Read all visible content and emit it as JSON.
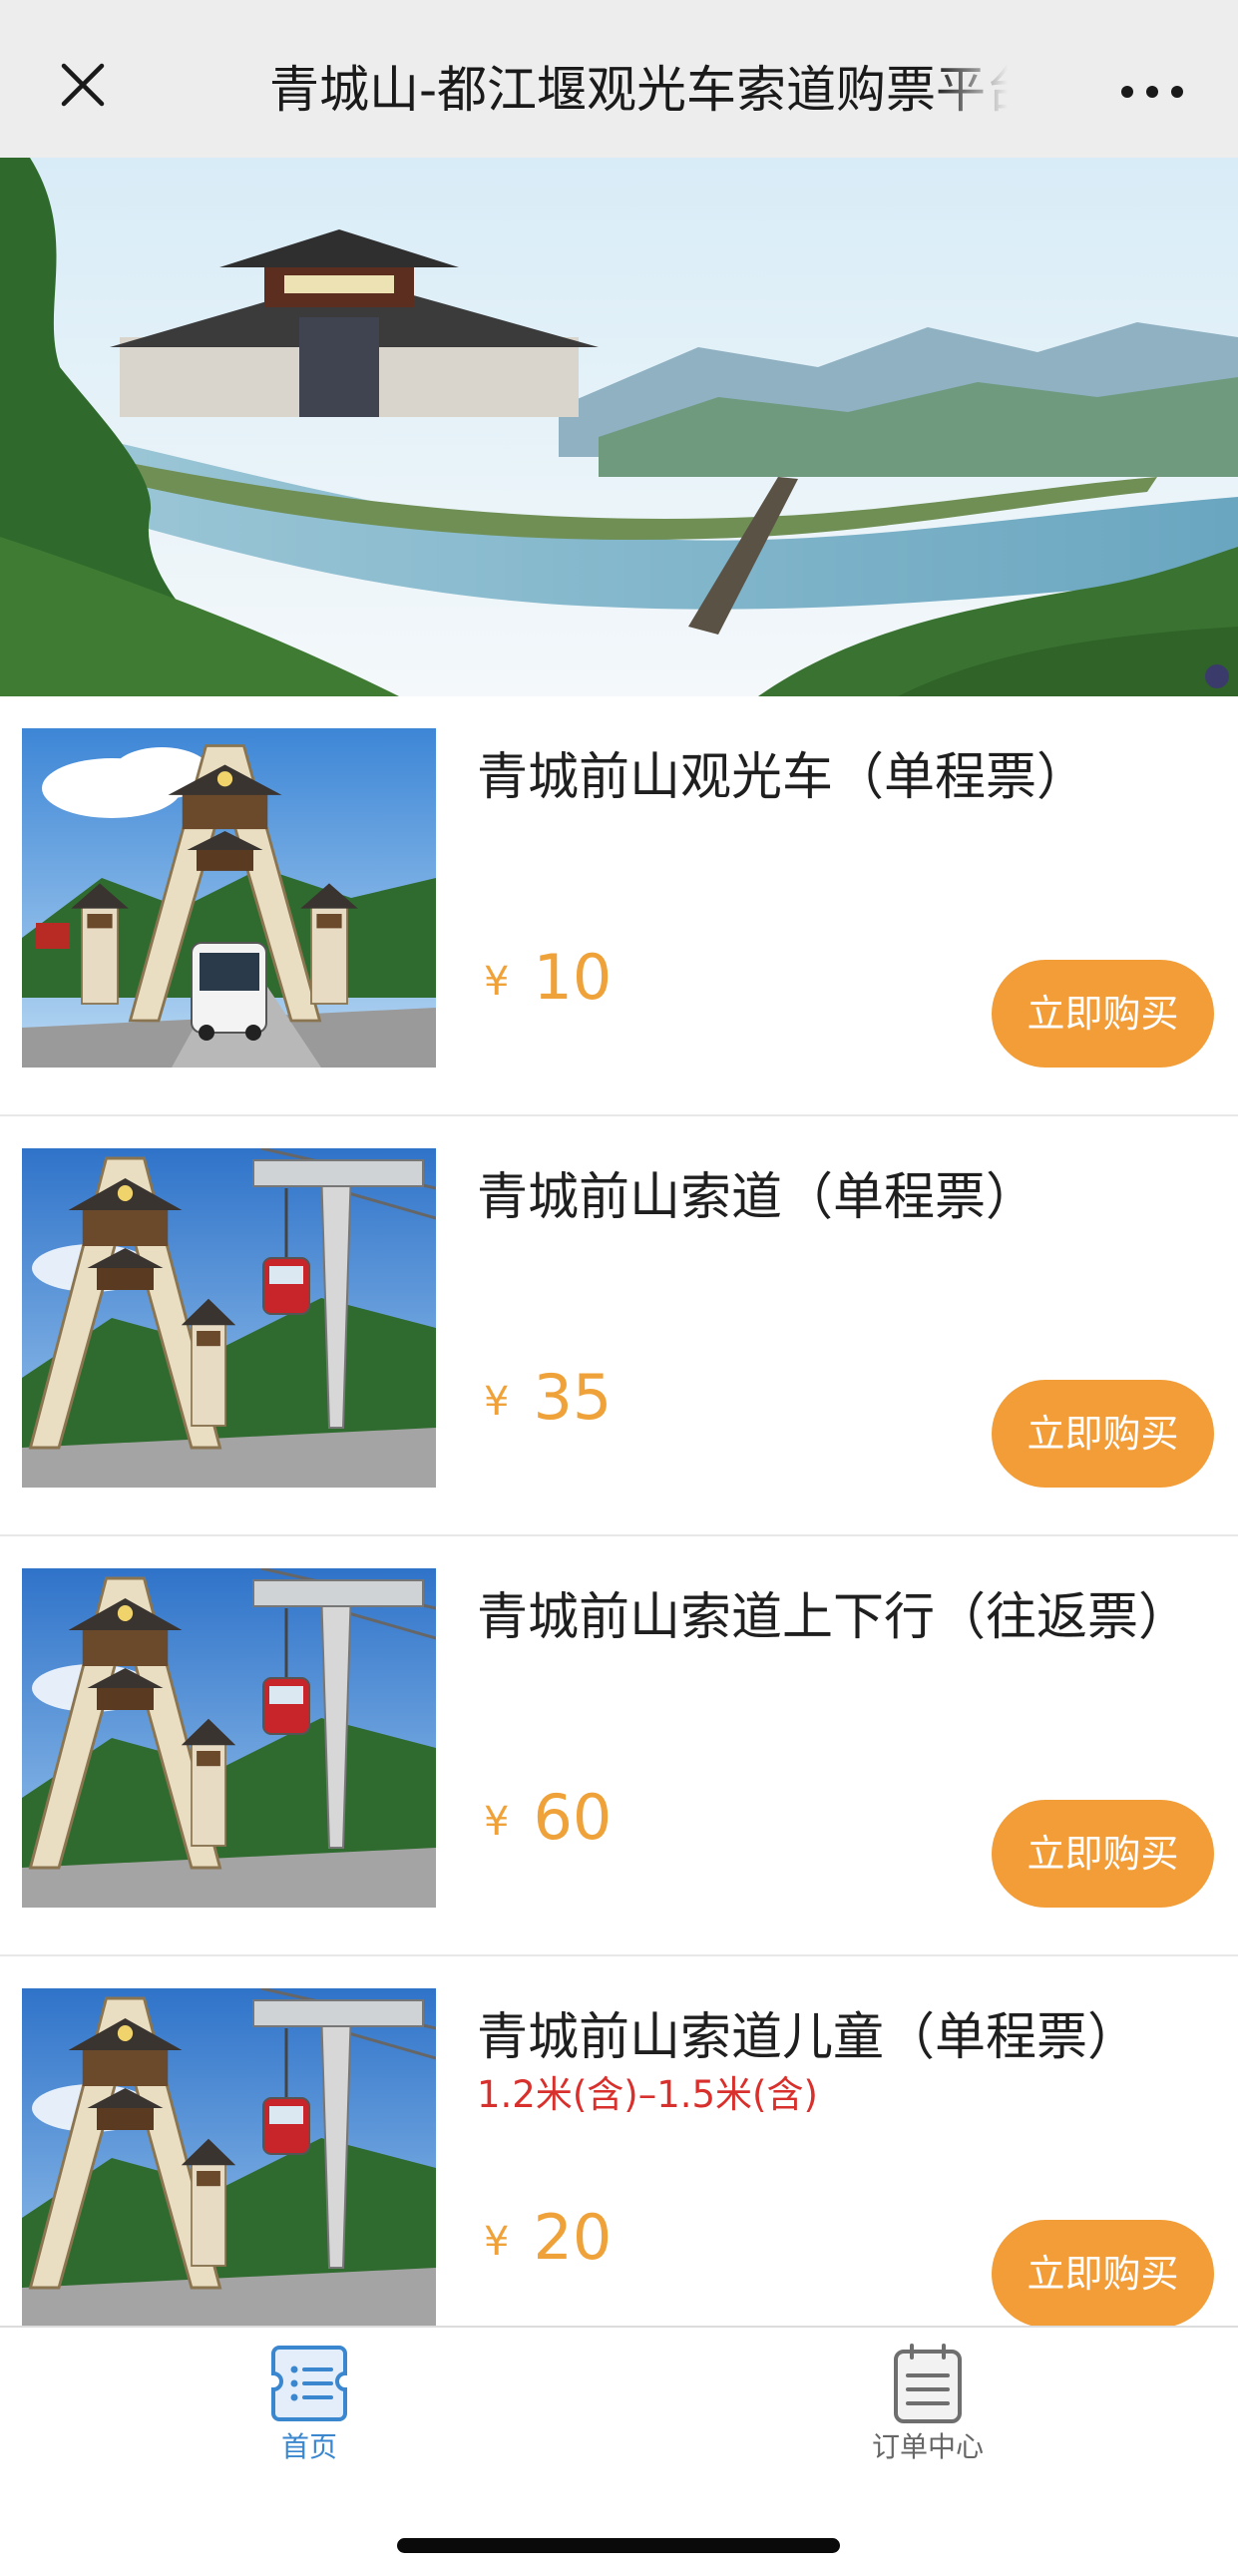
{
  "navbar": {
    "title": "青城山-都江堰观光车索道购票平台",
    "close_icon": "close-icon",
    "more_icon": "more-dots-icon"
  },
  "banner": {
    "image": "dujiangyan-scenic-banner"
  },
  "tickets": [
    {
      "name": "青城前山观光车（单程票）",
      "note": "",
      "currency": "¥",
      "price": "10",
      "buy_label": "立即购买",
      "thumb": "sightseeing-bus-photo"
    },
    {
      "name": "青城前山索道（单程票）",
      "note": "",
      "currency": "¥",
      "price": "35",
      "buy_label": "立即购买",
      "thumb": "cable-car-photo"
    },
    {
      "name": "青城前山索道上下行（往返票）",
      "note": "",
      "currency": "¥",
      "price": "60",
      "buy_label": "立即购买",
      "thumb": "cable-car-photo"
    },
    {
      "name": "青城前山索道儿童（单程票）",
      "note": "1.2米(含)–1.5米(含)",
      "currency": "¥",
      "price": "20",
      "buy_label": "立即购买",
      "thumb": "cable-car-photo"
    }
  ],
  "tabbar": {
    "tabs": [
      {
        "label": "首页",
        "icon": "home-ticket-icon",
        "active": true
      },
      {
        "label": "订单中心",
        "icon": "order-list-icon",
        "active": false
      }
    ]
  },
  "colors": {
    "accent": "#f29d38",
    "price": "#f0a23a",
    "note": "#d8302c",
    "tab_active": "#3a87cf",
    "tab_inactive": "#666666",
    "navbar_bg": "#ededed"
  }
}
